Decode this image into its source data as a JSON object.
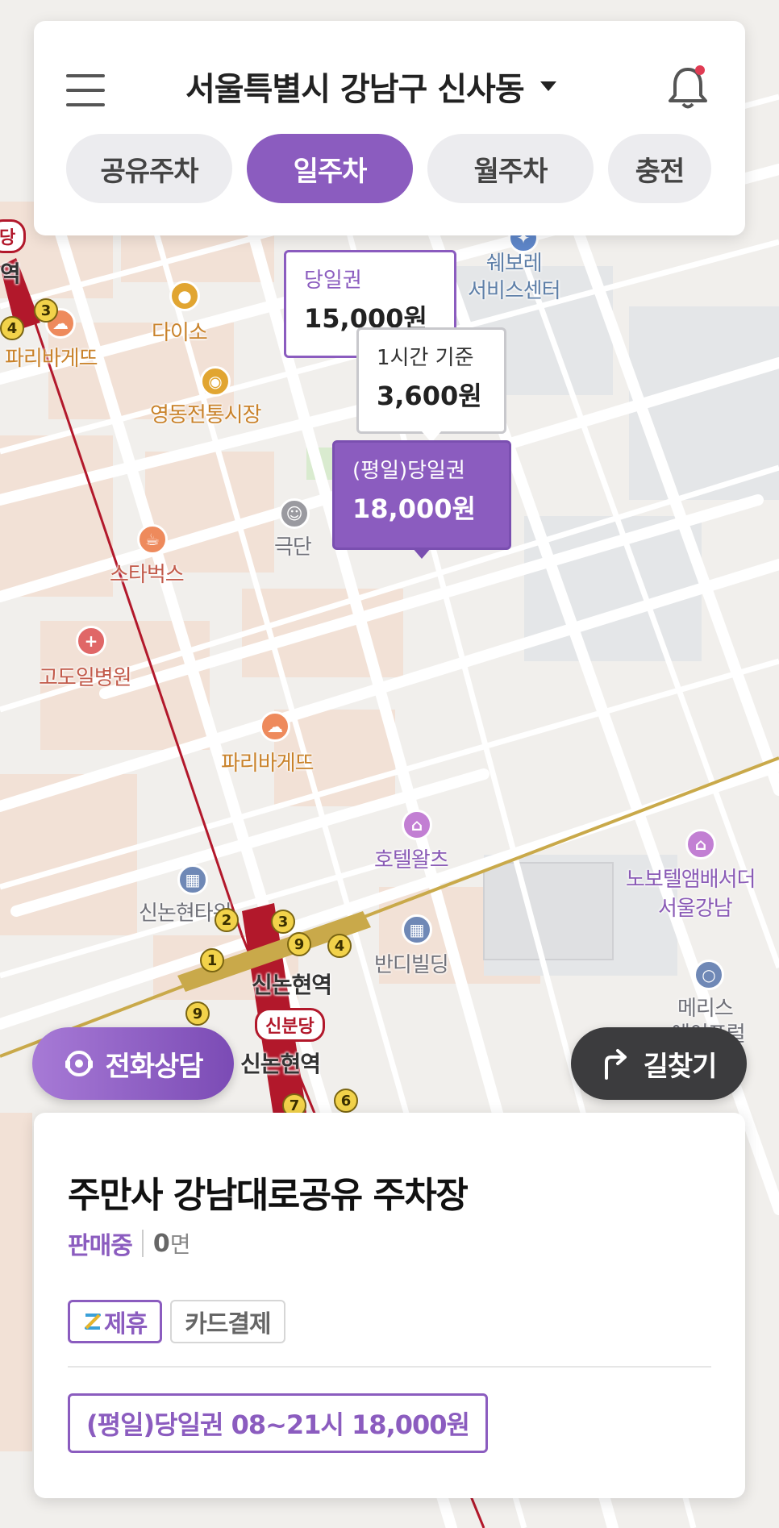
{
  "header": {
    "location": "서울특별시 강남구 신사동",
    "tabs": [
      {
        "label": "공유주차",
        "active": false
      },
      {
        "label": "일주차",
        "active": true
      },
      {
        "label": "월주차",
        "active": false
      },
      {
        "label": "충전",
        "active": false
      }
    ]
  },
  "map": {
    "labels": {
      "shevrolet": "쉐보레\n서비스센터",
      "daiso": "다이소",
      "paris1": "파리바게뜨",
      "market": "영동전통시장",
      "theater": "극단",
      "starbucks": "스타벅스",
      "hospital": "고도일병원",
      "paris2": "파리바게뜨",
      "hotel": "호텔왈츠",
      "novotel1": "노보텔앰배서더",
      "novotel2": "서울강남",
      "bldg1": "신논현타워",
      "bandi": "반디빌딩",
      "station1": "신논현역",
      "station2": "신논현역",
      "badge": "신분당",
      "meris1": "메리스",
      "meris2": "에이프럴",
      "left_station": "역",
      "left_badge": "당"
    },
    "markers": [
      {
        "title": "당일권",
        "value": "15,000원",
        "style": "outline"
      },
      {
        "title": "1시간 기준",
        "value": "3,600원",
        "style": "gray"
      },
      {
        "title": "(평일)당일권",
        "value": "18,000원",
        "style": "selected"
      }
    ]
  },
  "actions": {
    "call": "전화상담",
    "directions": "길찾기"
  },
  "lot": {
    "name": "주만사 강남대로공유 주차장",
    "status": "판매중",
    "spaces": "0",
    "spaces_unit": "면",
    "tags": [
      "제휴",
      "카드결제"
    ],
    "ticket": "(평일)당일권 08~21시 18,000원"
  },
  "colors": {
    "accent": "#8b5cbf",
    "subway_red": "#b2182b",
    "subway_gold": "#c9a94a"
  }
}
